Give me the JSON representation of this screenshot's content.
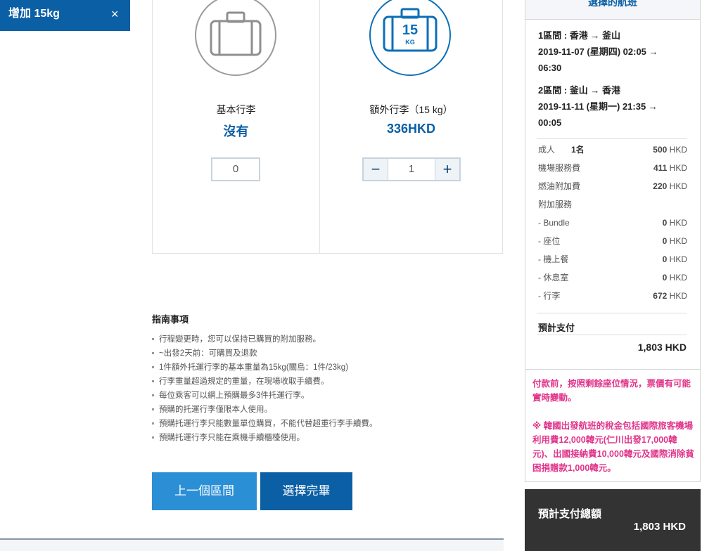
{
  "header": {
    "title": "增加 15kg",
    "close_label": "×"
  },
  "baggage": {
    "basic": {
      "label": "基本行李",
      "price": "沒有",
      "qty": "0"
    },
    "extra": {
      "label": "額外行李（15 kg）",
      "price": "336HKD",
      "qty": "1",
      "badge_weight": "15",
      "badge_unit": "KG",
      "minus": "−",
      "plus": "+"
    }
  },
  "notes": {
    "title": "指南事項",
    "items": [
      "行程變更時，您可以保持已購買的附加服務。",
      "~出發2天前：可購買及退款",
      "1件額外托運行李的基本重量為15kg(關島：1件/23kg)",
      "行李重量超過規定的重量，在現場收取手續費。",
      "每位乘客可以網上預購最多3件托運行李。",
      "預購的托運行李僅限本人使用。",
      "預購托運行李只能數量單位購買，不能代替超重行李手續費。",
      "預購托運行李只能在乘機手續櫃檯使用。"
    ]
  },
  "buttons": {
    "prev": "上一個區間",
    "done": "選擇完畢"
  },
  "summary": {
    "title": "選擇的航班",
    "segments": [
      {
        "head": "1區間 : 香港 → 釜山",
        "line1": "2019-11-07 (星期四) 02:05 →",
        "line2": "06:30"
      },
      {
        "head": "2區間 : 釜山 → 香港",
        "line1": "2019-11-11 (星期一) 21:35 →",
        "line2": "00:05"
      }
    ],
    "rows": [
      {
        "label": "成人",
        "qty": "1名",
        "amount": "500",
        "currency": "HKD"
      },
      {
        "label": "機場服務費",
        "amount": "411",
        "currency": "HKD"
      },
      {
        "label": "燃油附加費",
        "amount": "220",
        "currency": "HKD"
      },
      {
        "label": "附加服務",
        "amount": "",
        "currency": ""
      },
      {
        "label": "- Bundle",
        "amount": "0",
        "currency": "HKD"
      },
      {
        "label": "- 座位",
        "amount": "0",
        "currency": "HKD"
      },
      {
        "label": "- 機上餐",
        "amount": "0",
        "currency": "HKD"
      },
      {
        "label": "- 休息室",
        "amount": "0",
        "currency": "HKD"
      },
      {
        "label": "- 行李",
        "amount": "672",
        "currency": "HKD"
      }
    ],
    "total_label": "預計支付",
    "total_amount": "1,803 HKD"
  },
  "notice": {
    "p1": "付款前，按照剩餘座位情況，票價有可能實時變動。",
    "p2": "※ 韓國出發航班的稅金包括國際旅客機場利用費12,000韓元(仁川出發17,000韓元)、出國接納費10,000韓元及國際消除貧困捐贈款1,000韓元。"
  },
  "grand_total": {
    "label": "預計支付總額",
    "amount": "1,803 HKD"
  },
  "colors": {
    "brand": "#0b5fa5",
    "accent": "#2b8fd6",
    "notice": "#e0348a",
    "dark": "#333333"
  }
}
